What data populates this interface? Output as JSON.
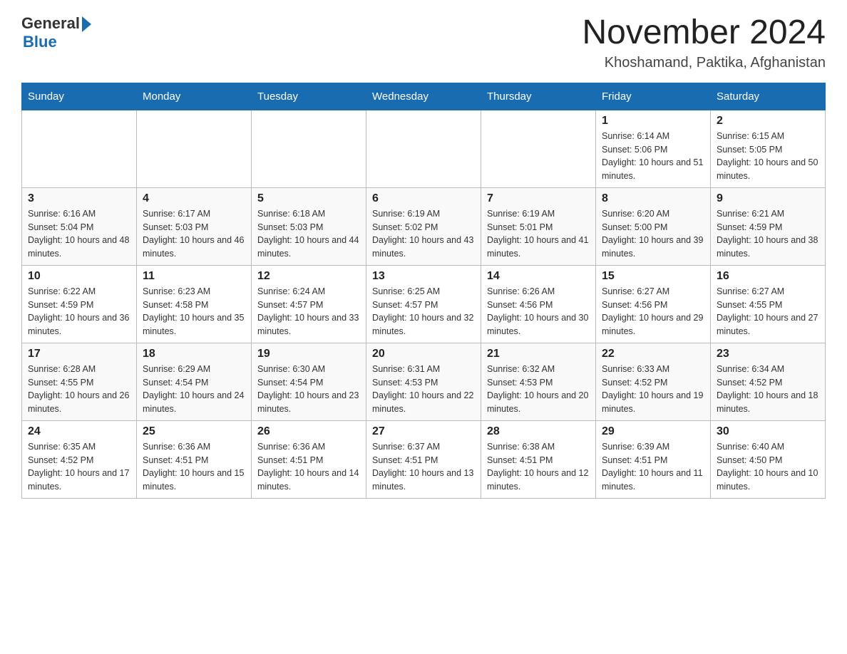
{
  "header": {
    "logo_general": "General",
    "logo_blue": "Blue",
    "month_title": "November 2024",
    "location": "Khoshamand, Paktika, Afghanistan"
  },
  "days_of_week": [
    "Sunday",
    "Monday",
    "Tuesday",
    "Wednesday",
    "Thursday",
    "Friday",
    "Saturday"
  ],
  "weeks": [
    [
      {
        "day": "",
        "info": ""
      },
      {
        "day": "",
        "info": ""
      },
      {
        "day": "",
        "info": ""
      },
      {
        "day": "",
        "info": ""
      },
      {
        "day": "",
        "info": ""
      },
      {
        "day": "1",
        "info": "Sunrise: 6:14 AM\nSunset: 5:06 PM\nDaylight: 10 hours and 51 minutes."
      },
      {
        "day": "2",
        "info": "Sunrise: 6:15 AM\nSunset: 5:05 PM\nDaylight: 10 hours and 50 minutes."
      }
    ],
    [
      {
        "day": "3",
        "info": "Sunrise: 6:16 AM\nSunset: 5:04 PM\nDaylight: 10 hours and 48 minutes."
      },
      {
        "day": "4",
        "info": "Sunrise: 6:17 AM\nSunset: 5:03 PM\nDaylight: 10 hours and 46 minutes."
      },
      {
        "day": "5",
        "info": "Sunrise: 6:18 AM\nSunset: 5:03 PM\nDaylight: 10 hours and 44 minutes."
      },
      {
        "day": "6",
        "info": "Sunrise: 6:19 AM\nSunset: 5:02 PM\nDaylight: 10 hours and 43 minutes."
      },
      {
        "day": "7",
        "info": "Sunrise: 6:19 AM\nSunset: 5:01 PM\nDaylight: 10 hours and 41 minutes."
      },
      {
        "day": "8",
        "info": "Sunrise: 6:20 AM\nSunset: 5:00 PM\nDaylight: 10 hours and 39 minutes."
      },
      {
        "day": "9",
        "info": "Sunrise: 6:21 AM\nSunset: 4:59 PM\nDaylight: 10 hours and 38 minutes."
      }
    ],
    [
      {
        "day": "10",
        "info": "Sunrise: 6:22 AM\nSunset: 4:59 PM\nDaylight: 10 hours and 36 minutes."
      },
      {
        "day": "11",
        "info": "Sunrise: 6:23 AM\nSunset: 4:58 PM\nDaylight: 10 hours and 35 minutes."
      },
      {
        "day": "12",
        "info": "Sunrise: 6:24 AM\nSunset: 4:57 PM\nDaylight: 10 hours and 33 minutes."
      },
      {
        "day": "13",
        "info": "Sunrise: 6:25 AM\nSunset: 4:57 PM\nDaylight: 10 hours and 32 minutes."
      },
      {
        "day": "14",
        "info": "Sunrise: 6:26 AM\nSunset: 4:56 PM\nDaylight: 10 hours and 30 minutes."
      },
      {
        "day": "15",
        "info": "Sunrise: 6:27 AM\nSunset: 4:56 PM\nDaylight: 10 hours and 29 minutes."
      },
      {
        "day": "16",
        "info": "Sunrise: 6:27 AM\nSunset: 4:55 PM\nDaylight: 10 hours and 27 minutes."
      }
    ],
    [
      {
        "day": "17",
        "info": "Sunrise: 6:28 AM\nSunset: 4:55 PM\nDaylight: 10 hours and 26 minutes."
      },
      {
        "day": "18",
        "info": "Sunrise: 6:29 AM\nSunset: 4:54 PM\nDaylight: 10 hours and 24 minutes."
      },
      {
        "day": "19",
        "info": "Sunrise: 6:30 AM\nSunset: 4:54 PM\nDaylight: 10 hours and 23 minutes."
      },
      {
        "day": "20",
        "info": "Sunrise: 6:31 AM\nSunset: 4:53 PM\nDaylight: 10 hours and 22 minutes."
      },
      {
        "day": "21",
        "info": "Sunrise: 6:32 AM\nSunset: 4:53 PM\nDaylight: 10 hours and 20 minutes."
      },
      {
        "day": "22",
        "info": "Sunrise: 6:33 AM\nSunset: 4:52 PM\nDaylight: 10 hours and 19 minutes."
      },
      {
        "day": "23",
        "info": "Sunrise: 6:34 AM\nSunset: 4:52 PM\nDaylight: 10 hours and 18 minutes."
      }
    ],
    [
      {
        "day": "24",
        "info": "Sunrise: 6:35 AM\nSunset: 4:52 PM\nDaylight: 10 hours and 17 minutes."
      },
      {
        "day": "25",
        "info": "Sunrise: 6:36 AM\nSunset: 4:51 PM\nDaylight: 10 hours and 15 minutes."
      },
      {
        "day": "26",
        "info": "Sunrise: 6:36 AM\nSunset: 4:51 PM\nDaylight: 10 hours and 14 minutes."
      },
      {
        "day": "27",
        "info": "Sunrise: 6:37 AM\nSunset: 4:51 PM\nDaylight: 10 hours and 13 minutes."
      },
      {
        "day": "28",
        "info": "Sunrise: 6:38 AM\nSunset: 4:51 PM\nDaylight: 10 hours and 12 minutes."
      },
      {
        "day": "29",
        "info": "Sunrise: 6:39 AM\nSunset: 4:51 PM\nDaylight: 10 hours and 11 minutes."
      },
      {
        "day": "30",
        "info": "Sunrise: 6:40 AM\nSunset: 4:50 PM\nDaylight: 10 hours and 10 minutes."
      }
    ]
  ]
}
